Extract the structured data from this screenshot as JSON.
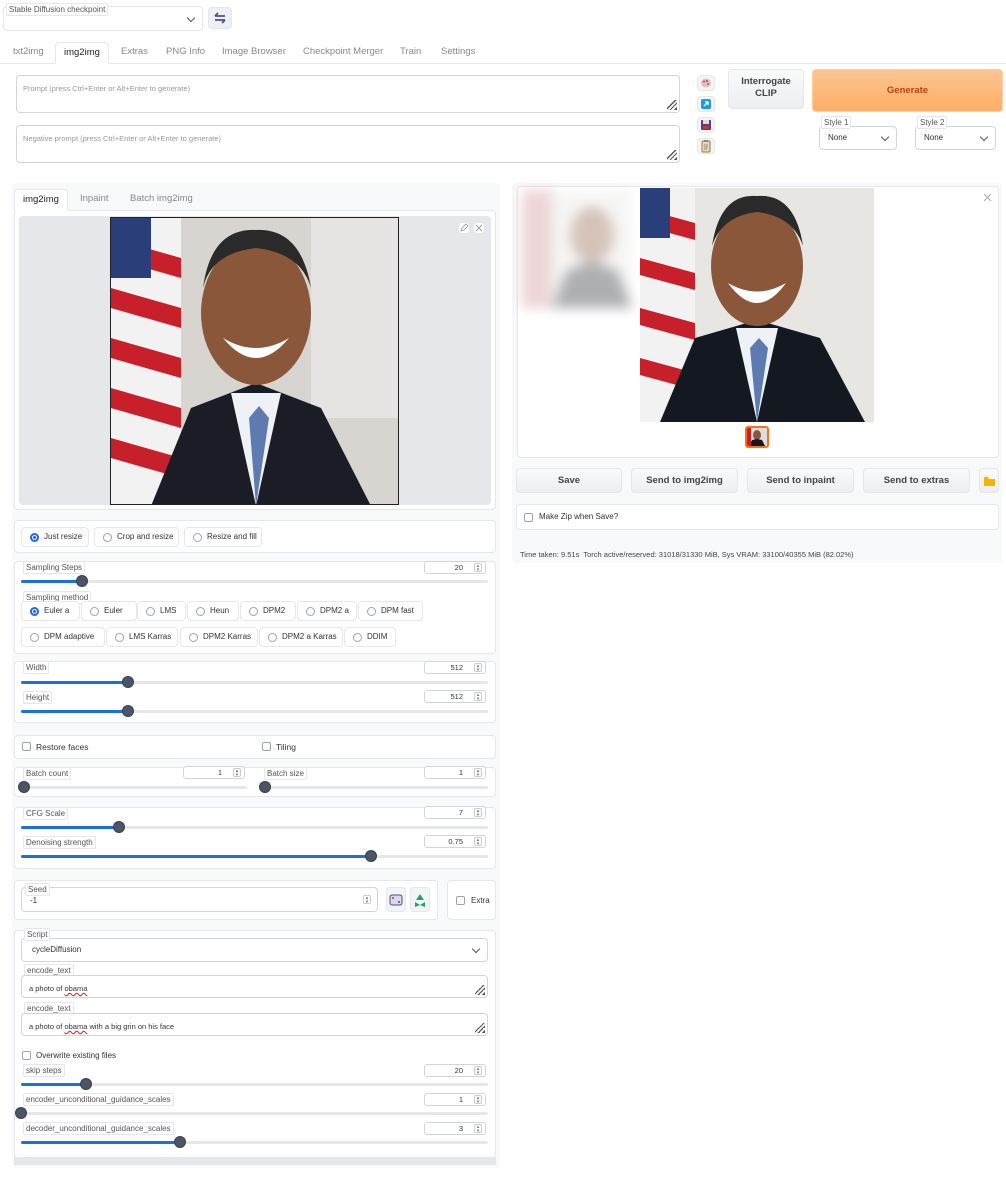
{
  "checkpoint": {
    "legend": "Stable Diffusion checkpoint",
    "value": ""
  },
  "tabs": [
    "txt2img",
    "img2img",
    "Extras",
    "PNG Info",
    "Image Browser",
    "Checkpoint Merger",
    "Train",
    "Settings"
  ],
  "active_tab": "img2img",
  "prompt": {
    "placeholder": "Prompt (press Ctrl+Enter or Alt+Enter to generate)",
    "value": ""
  },
  "negative_prompt": {
    "placeholder": "Negative prompt (press Ctrl+Enter or Alt+Enter to generate)",
    "value": ""
  },
  "buttons": {
    "interrogate": "Interrogate\nCLIP",
    "interrogate_l1": "Interrogate",
    "interrogate_l2": "CLIP",
    "generate": "Generate"
  },
  "styles": [
    {
      "legend": "Style 1",
      "value": "None"
    },
    {
      "legend": "Style 2",
      "value": "None"
    }
  ],
  "img2img_tabs": [
    "img2img",
    "Inpaint",
    "Batch img2img"
  ],
  "resize_modes": {
    "options": [
      "Just resize",
      "Crop and resize",
      "Resize and fill"
    ],
    "selected": "Just resize"
  },
  "sampling_steps": {
    "label": "Sampling Steps",
    "value": "20",
    "fraction": 0.13
  },
  "sampling_method": {
    "label": "Sampling method",
    "options": [
      "Euler a",
      "Euler",
      "LMS",
      "Heun",
      "DPM2",
      "DPM2 a",
      "DPM fast",
      "DPM adaptive",
      "LMS Karras",
      "DPM2 Karras",
      "DPM2 a Karras",
      "DDIM"
    ],
    "selected": "Euler a"
  },
  "width": {
    "label": "Width",
    "value": "512",
    "fraction": 0.23
  },
  "height": {
    "label": "Height",
    "value": "512",
    "fraction": 0.23
  },
  "restore_faces": {
    "label": "Restore faces",
    "checked": false
  },
  "tiling": {
    "label": "Tiling",
    "checked": false
  },
  "batch_count": {
    "label": "Batch count",
    "value": "1",
    "fraction": 0.0
  },
  "batch_size": {
    "label": "Batch size",
    "value": "1",
    "fraction": 0.0
  },
  "cfg_scale": {
    "label": "CFG Scale",
    "value": "7",
    "fraction": 0.21
  },
  "denoising": {
    "label": "Denoising strength",
    "value": "0.75",
    "fraction": 0.75
  },
  "seed": {
    "label": "Seed",
    "value": "-1"
  },
  "extra": {
    "label": "Extra",
    "checked": false
  },
  "script": {
    "label": "Script",
    "value": "cycleDiffusion"
  },
  "encode_text_1": {
    "label": "encode_text",
    "value_prefix": "a photo of ",
    "value_word": "obama",
    "value_suffix": ""
  },
  "encode_text_2": {
    "label": "encode_text",
    "value_prefix": "a photo of ",
    "value_word": "obama",
    "value_suffix": " with a big grin on his face"
  },
  "overwrite": {
    "label": "Overwrite existing files",
    "checked": false
  },
  "skip_steps": {
    "label": "skip steps",
    "value": "20",
    "fraction": 0.14
  },
  "encoder_scales": {
    "label": "encoder_unconditional_guidance_scales",
    "value": "1",
    "fraction": 0.0
  },
  "decoder_scales": {
    "label": "decoder_unconditional_guidance_scales",
    "value": "3",
    "fraction": 0.34
  },
  "output_buttons": [
    "Save",
    "Send to img2img",
    "Send to inpaint",
    "Send to extras"
  ],
  "make_zip": {
    "label": "Make Zip when Save?",
    "checked": false
  },
  "status": "Time taken: 9.51s  Torch active/reserved: 31018/31330 MiB, Sys VRAM: 33100/40355 MiB (82.02%)",
  "colors": {
    "accent": "#1d6fe0",
    "generate_bg": "#fdba74",
    "generate_text": "#c2410c",
    "knob": "#4b5563"
  },
  "icons": [
    "refresh-icon",
    "paint-palette-icon",
    "bookmark-arrow-icon",
    "save-icon",
    "clipboard-icon",
    "pencil-icon",
    "close-icon",
    "dice-icon",
    "recycle-icon",
    "folder-icon"
  ]
}
